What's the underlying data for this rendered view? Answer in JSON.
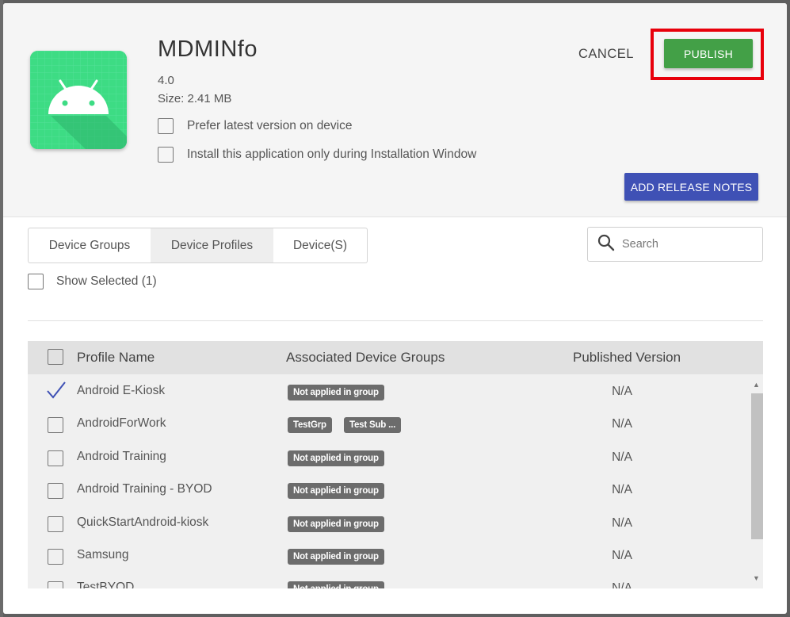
{
  "app": {
    "name": "MDMINfo",
    "version": "4.0",
    "size": "Size: 2.41 MB"
  },
  "options": [
    {
      "label": "Prefer latest version on device",
      "checked": false
    },
    {
      "label": "Install this application only during Installation Window",
      "checked": false
    }
  ],
  "actions": {
    "cancel": "CANCEL",
    "publish": "PUBLISH",
    "release_notes": "ADD RELEASE NOTES"
  },
  "tabs": [
    {
      "label": "Device Groups",
      "active": false
    },
    {
      "label": "Device Profiles",
      "active": true
    },
    {
      "label": "Device(S)",
      "active": false
    }
  ],
  "search": {
    "placeholder": "Search",
    "icon": "search-icon"
  },
  "show_selected": {
    "label": "Show Selected (1)",
    "checked": false
  },
  "table": {
    "columns": [
      "Profile Name",
      "Associated Device Groups",
      "Published Version"
    ],
    "rows": [
      {
        "name": "Android E-Kiosk",
        "selected": true,
        "groups": [
          "Not applied in group"
        ],
        "version": "N/A"
      },
      {
        "name": "AndroidForWork",
        "selected": false,
        "groups": [
          "TestGrp",
          "Test Sub ..."
        ],
        "version": "N/A"
      },
      {
        "name": "Android Training",
        "selected": false,
        "groups": [
          "Not applied in group"
        ],
        "version": "N/A"
      },
      {
        "name": "Android Training - BYOD",
        "selected": false,
        "groups": [
          "Not applied in group"
        ],
        "version": "N/A"
      },
      {
        "name": "QuickStartAndroid-kiosk",
        "selected": false,
        "groups": [
          "Not applied in group"
        ],
        "version": "N/A"
      },
      {
        "name": "Samsung",
        "selected": false,
        "groups": [
          "Not applied in group"
        ],
        "version": "N/A"
      },
      {
        "name": "TestBYOD",
        "selected": false,
        "groups": [
          "Not applied in group"
        ],
        "version": "N/A"
      }
    ]
  },
  "colors": {
    "publish": "#43a047",
    "publish_highlight": "#e8000b",
    "release_notes": "#3f51b5",
    "app_icon_bg": "#3ddc84",
    "check": "#3f51b5"
  }
}
